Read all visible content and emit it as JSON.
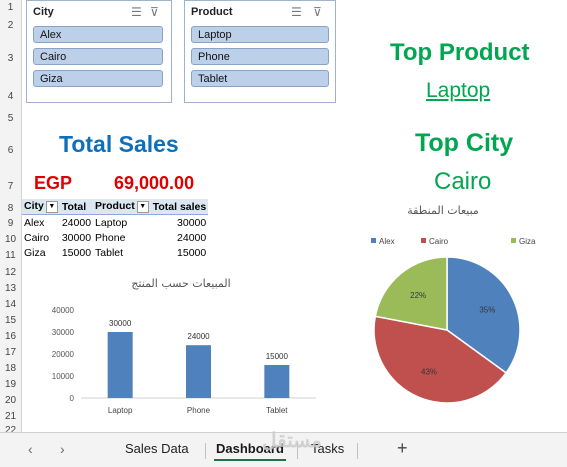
{
  "rows": [
    "1",
    "2",
    "3",
    "4",
    "5",
    "6",
    "7",
    "8",
    "9",
    "10",
    "11",
    "12",
    "13",
    "14",
    "15",
    "16",
    "17",
    "18",
    "19",
    "20",
    "21",
    "22"
  ],
  "slicers": {
    "city": {
      "title": "City",
      "items": [
        "Alex",
        "Cairo",
        "Giza"
      ]
    },
    "product": {
      "title": "Product",
      "items": [
        "Laptop",
        "Phone",
        "Tablet"
      ]
    }
  },
  "top_product": {
    "label": "Top Product",
    "value": "Laptop"
  },
  "total_sales": {
    "label": "Total Sales",
    "currency": "EGP",
    "value": "69,000.00"
  },
  "top_city": {
    "label": "Top City",
    "value": "Cairo"
  },
  "pivot": {
    "headers": [
      "City",
      "Total",
      "Product",
      "Total sales"
    ],
    "rows": [
      [
        "Alex",
        "24000",
        "Laptop",
        "30000"
      ],
      [
        "Cairo",
        "30000",
        "Phone",
        "24000"
      ],
      [
        "Giza",
        "15000",
        "Tablet",
        "15000"
      ]
    ]
  },
  "chart_data": [
    {
      "type": "bar",
      "title": "المبيعات حسب المنتج",
      "categories": [
        "Laptop",
        "Phone",
        "Tablet"
      ],
      "values": [
        30000,
        24000,
        15000
      ],
      "yticks": [
        "0",
        "10000",
        "20000",
        "30000",
        "40000"
      ],
      "ylim": [
        0,
        40000
      ],
      "color": "#4f81bd"
    },
    {
      "type": "pie",
      "title": "مبيعات المنطقة",
      "legend_position": "top",
      "series": [
        {
          "name": "Alex",
          "value": 35,
          "label": "35%",
          "color": "#4f81bd"
        },
        {
          "name": "Cairo",
          "value": 43,
          "label": "43%",
          "color": "#c0504d"
        },
        {
          "name": "Giza",
          "value": 22,
          "label": "22%",
          "color": "#9bbb59"
        }
      ]
    }
  ],
  "tabs": {
    "prev": "‹",
    "next": "›",
    "items": [
      "Sales Data",
      "Dashboard",
      "Tasks"
    ],
    "add": "+",
    "watermark": "مستقل"
  },
  "colors": {
    "green": "#00a650",
    "blue": "#0f6fb8",
    "red": "#e00000",
    "excel_green": "#217346"
  }
}
